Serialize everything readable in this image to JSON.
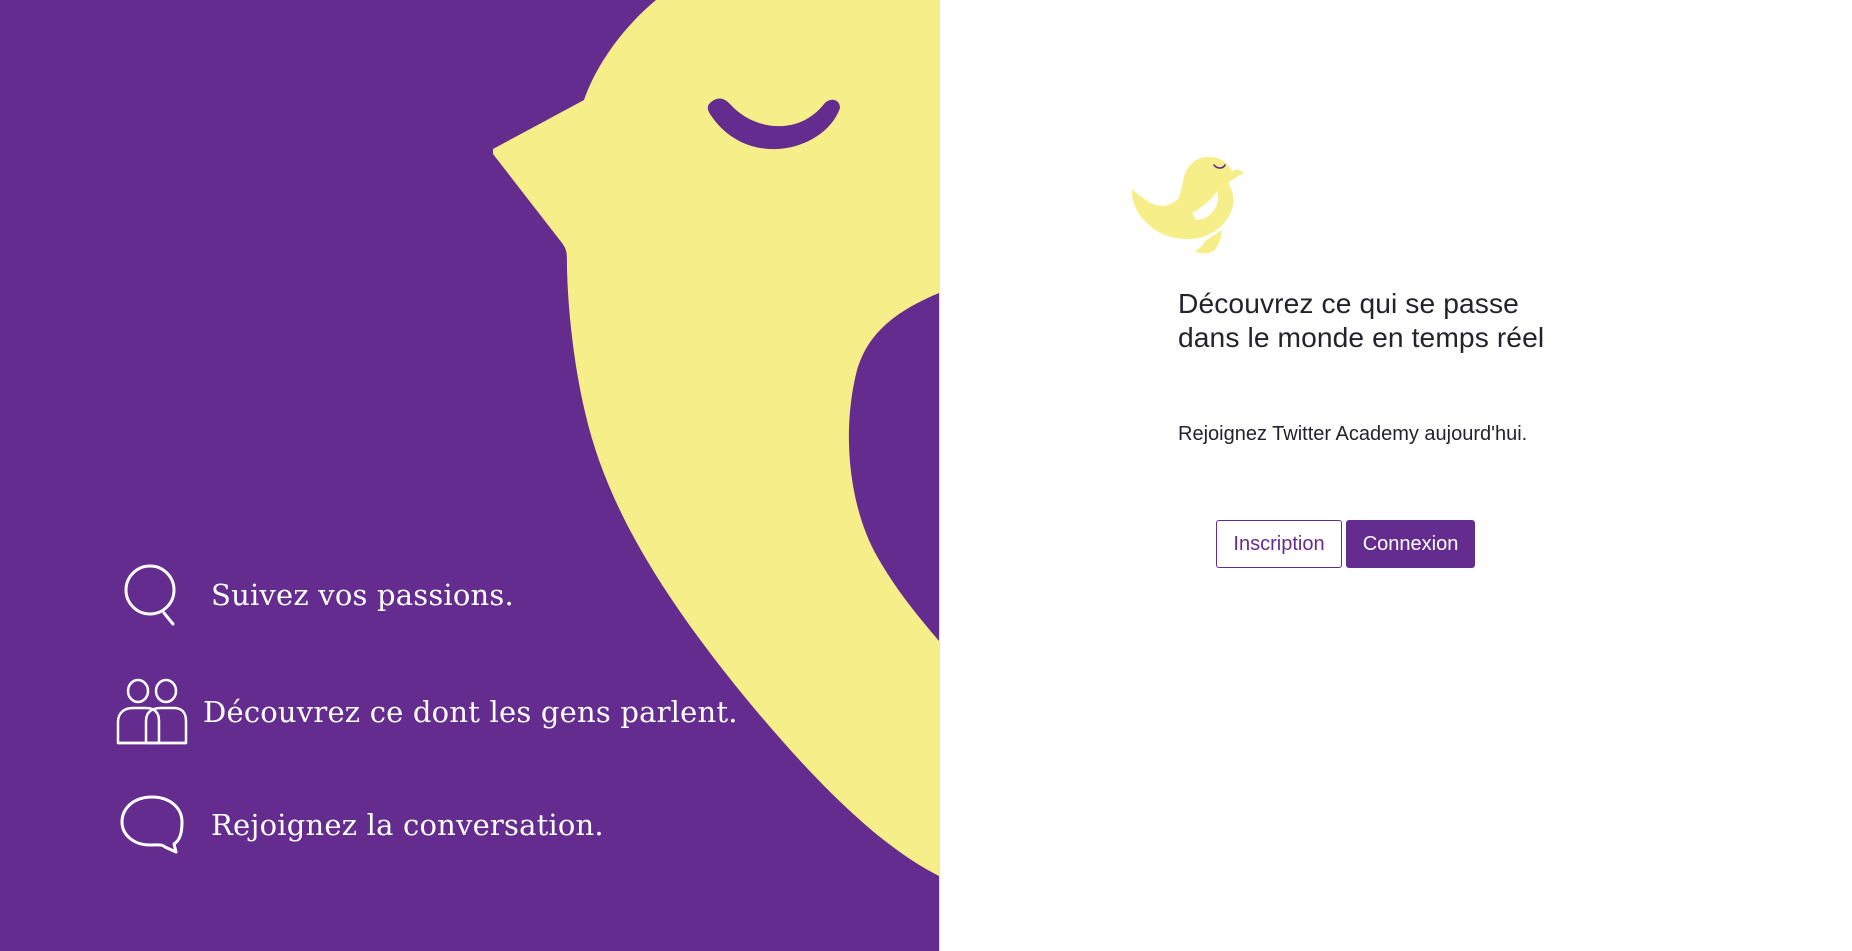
{
  "colors": {
    "brand_purple": "#652c90",
    "brand_yellow": "#f6ee88",
    "text_dark": "#24232b",
    "white": "#ffffff"
  },
  "left_panel": {
    "features": [
      {
        "icon": "search-icon",
        "label": "Suivez vos passions."
      },
      {
        "icon": "people-icon",
        "label": "Découvrez ce dont les gens parlent."
      },
      {
        "icon": "speech-bubble-icon",
        "label": "Rejoignez la conversation."
      }
    ]
  },
  "right_panel": {
    "logo_icon": "bird-logo-icon",
    "headline": "Découvrez ce qui se passe dans le monde en temps réel",
    "subtitle": "Rejoignez Twitter Academy aujourd'hui.",
    "buttons": {
      "signup_label": "Inscription",
      "login_label": "Connexion"
    }
  }
}
